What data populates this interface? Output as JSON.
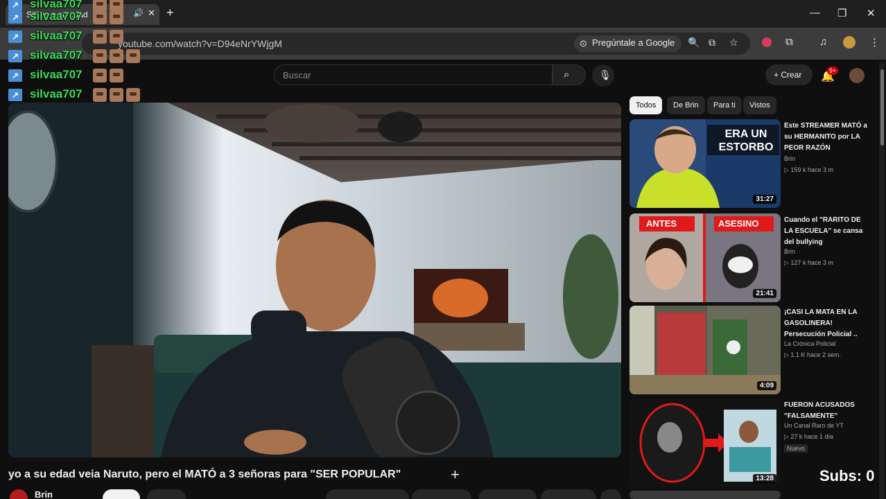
{
  "browser": {
    "tab_title": "Siti yo a su edad",
    "url": "youtube.com/watch?v=D94eNrYWjgM",
    "ask_google": "Pregúntale a Google",
    "notifications": "9+"
  },
  "chat": {
    "messages": [
      {
        "user": "silvaa707"
      },
      {
        "user": "silvaa707"
      },
      {
        "user": "silvaa707"
      },
      {
        "user": "silvaa707"
      },
      {
        "user": "silvaa707"
      }
    ]
  },
  "header": {
    "search_placeholder": "Buscar",
    "create_label": "Crear"
  },
  "video": {
    "title": "yo a su edad veia Naruto, pero el MATÓ a 3 señoras para \"SER POPULAR\"",
    "channel": "Brin"
  },
  "chips": [
    "Todos",
    "De Brin",
    "Para ti",
    "Vistos"
  ],
  "recommendations": [
    {
      "title": "Este STREAMER MATÓ a su HERMANITO por LA PEOR RAZÓN",
      "channel": "Brin",
      "meta": "▷ 159 k  hace 3 m",
      "duration": "31:27",
      "thumb_text": "ERA UN ESTORBO"
    },
    {
      "title": "Cuando el \"RARITO DE LA ESCUELA\" se cansa del bullying",
      "channel": "Brin",
      "meta": "▷ 127 k  hace 3 m",
      "duration": "21:41",
      "thumb_left": "ANTES",
      "thumb_right": "ASESINO"
    },
    {
      "title": "¡CASI LA MATA EN LA GASOLINERA! Persecución Policial ..",
      "channel": "La Crónica Policial",
      "meta": "▷ 1.1 K  hace 2 sem.",
      "duration": "4:09"
    },
    {
      "title": "FUERON ACUSADOS \"FALSAMENTE\"",
      "channel": "Un Canal Raro de YT",
      "meta": "▷ 27 k  hace 1 día",
      "duration": "13:28",
      "badge": "Nuevo"
    }
  ],
  "overlay": {
    "subs": "Subs: 0"
  },
  "colors": {
    "chat_user": "#3de05a",
    "accent_red": "#cc0000",
    "background": "#0f0f0f"
  }
}
